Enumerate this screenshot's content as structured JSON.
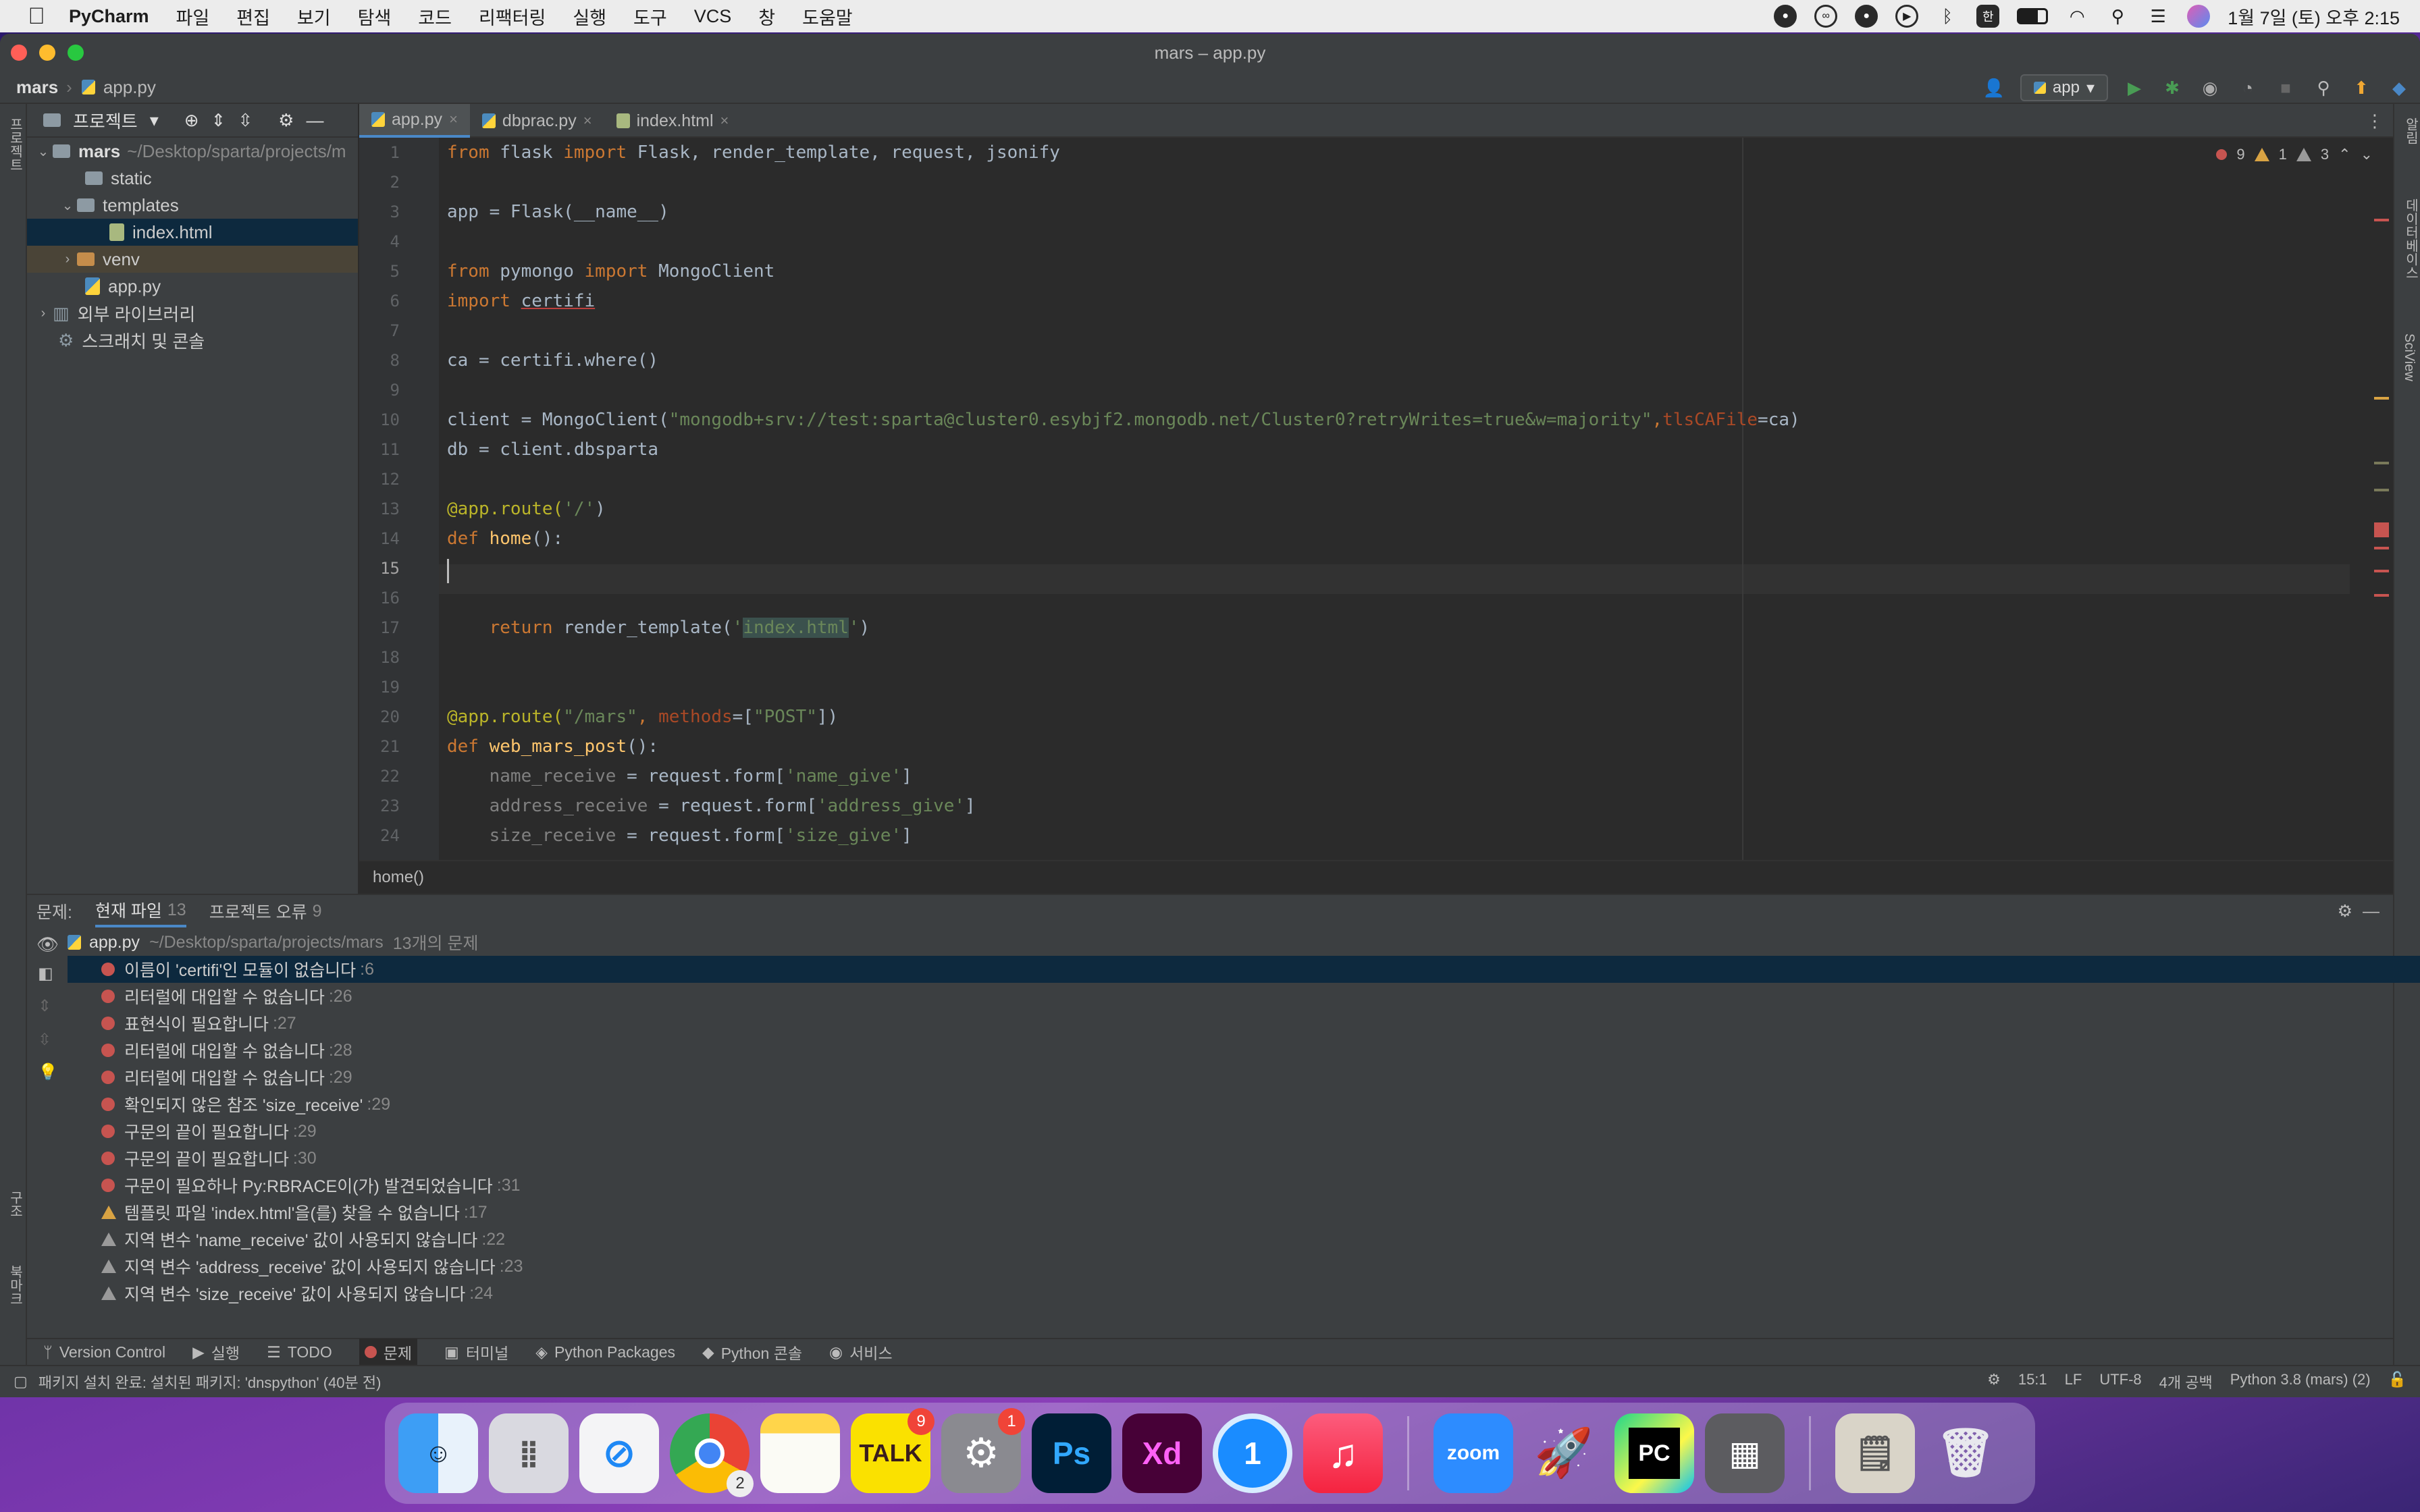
{
  "menubar": {
    "app": "PyCharm",
    "items": [
      "파일",
      "편집",
      "보기",
      "탐색",
      "코드",
      "리팩터링",
      "실행",
      "도구",
      "VCS",
      "창",
      "도움말"
    ],
    "clock": "1월 7일 (토) 오후 2:15",
    "ime": "한"
  },
  "window": {
    "title": "mars – app.py",
    "breadcrumb_project": "mars",
    "breadcrumb_file": "app.py",
    "run_config": "app"
  },
  "project_panel": {
    "title": "프로젝트",
    "root_name": "mars",
    "root_path": "~/Desktop/sparta/projects/m",
    "items": {
      "static": "static",
      "templates": "templates",
      "index": "index.html",
      "venv": "venv",
      "app": "app.py",
      "ext_libs": "외부 라이브러리",
      "scratches": "스크래치 및 콘솔"
    }
  },
  "tabs": [
    "app.py",
    "dbprac.py",
    "index.html"
  ],
  "inspections": {
    "errors": "9",
    "warnings": "1",
    "weak_warnings": "3"
  },
  "editor": {
    "current_line": "15",
    "breadcrumb": "home()",
    "lines": [
      {
        "n": "1"
      },
      {
        "n": "2"
      },
      {
        "n": "3"
      },
      {
        "n": "4"
      },
      {
        "n": "5"
      },
      {
        "n": "6"
      },
      {
        "n": "7"
      },
      {
        "n": "8"
      },
      {
        "n": "9"
      },
      {
        "n": "10"
      },
      {
        "n": "11"
      },
      {
        "n": "12"
      },
      {
        "n": "13"
      },
      {
        "n": "14"
      },
      {
        "n": "15"
      },
      {
        "n": "16"
      },
      {
        "n": "17"
      },
      {
        "n": "18"
      },
      {
        "n": "19"
      },
      {
        "n": "20"
      },
      {
        "n": "21"
      },
      {
        "n": "22"
      },
      {
        "n": "23"
      },
      {
        "n": "24"
      }
    ],
    "code": {
      "l1_from": "from",
      "l1_mod": " flask ",
      "l1_import": "import",
      "l1_rest": " Flask, render_template, request, jsonify",
      "l3": "app = Flask(__name__)",
      "l5_from": "from",
      "l5_mod": " pymongo ",
      "l5_import": "import",
      "l5_rest": " MongoClient",
      "l6_import": "import",
      "l6_mod": "certifi",
      "l8": "ca = certifi.where()",
      "l10_a": "client = MongoClient(",
      "l10_str": "\"mongodb+srv://test:sparta@cluster0.esybjf2.mongodb.net/Cluster0?retryWrites=true&w=majority\"",
      "l10_comma": ",",
      "l10_param": "tlsCAFile",
      "l10_end": "=ca)",
      "l11": "db = client.dbsparta",
      "l13_dec": "@app.route(",
      "l13_str": "'/'",
      "l13_end": ")",
      "l14_def": "def",
      "l14_fn": " home",
      "l14_end": "():",
      "l17_ret": "return",
      "l17_call": " render_template(",
      "l17_q1": "'",
      "l17_str": "index.html",
      "l17_q2": "'",
      "l17_end": ")",
      "l20_dec": "@app.route(",
      "l20_str": "\"/mars\"",
      "l20_comma": ", ",
      "l20_param": "methods",
      "l20_eq": "=[",
      "l20_post": "\"POST\"",
      "l20_end": "])",
      "l21_def": "def",
      "l21_fn": " web_mars_post",
      "l21_end": "():",
      "l22_var": "name_receive",
      "l22_mid": " = request.form[",
      "l22_str": "'name_give'",
      "l22_end": "]",
      "l23_var": "address_receive",
      "l23_mid": " = request.form[",
      "l23_str": "'address_give'",
      "l23_end": "]",
      "l24_var": "size_receive",
      "l24_mid": " = request.form[",
      "l24_str": "'size_give'",
      "l24_end": "]"
    }
  },
  "problems": {
    "label": "문제:",
    "tab_current": "현재 파일",
    "tab_current_count": "13",
    "tab_project": "프로젝트 오류",
    "tab_project_count": "9",
    "file": "app.py",
    "file_path": "~/Desktop/sparta/projects/mars",
    "file_count": "13개의 문제",
    "items": [
      {
        "text": "이름이 'certifi'인 모듈이 없습니다",
        "line": ":6"
      },
      {
        "text": "리터럴에 대입할 수 없습니다",
        "line": ":26"
      },
      {
        "text": "표현식이 필요합니다",
        "line": ":27"
      },
      {
        "text": "리터럴에 대입할 수 없습니다",
        "line": ":28"
      },
      {
        "text": "리터럴에 대입할 수 없습니다",
        "line": ":29"
      },
      {
        "text": "확인되지 않은 참조 'size_receive'",
        "line": ":29"
      },
      {
        "text": "구문의 끝이 필요합니다",
        "line": ":29"
      },
      {
        "text": "구문의 끝이 필요합니다",
        "line": ":30"
      },
      {
        "text": "구문이 필요하나 Py:RBRACE이(가) 발견되었습니다",
        "line": ":31"
      },
      {
        "text": "템플릿 파일 'index.html'을(를) 찾을 수 없습니다",
        "line": ":17"
      },
      {
        "text": "지역 변수 'name_receive' 값이 사용되지 않습니다",
        "line": ":22"
      },
      {
        "text": "지역 변수 'address_receive' 값이 사용되지 않습니다",
        "line": ":23"
      },
      {
        "text": "지역 변수 'size_receive' 값이 사용되지 않습니다",
        "line": ":24"
      }
    ]
  },
  "bottom_tools": [
    "Version Control",
    "실행",
    "TODO",
    "문제",
    "터미널",
    "Python Packages",
    "Python 콘솔",
    "서비스"
  ],
  "status": {
    "message": "패키지 설치 완료: 설치된 패키지: 'dnspython' (40분 전)",
    "position": "15:1",
    "line_sep": "LF",
    "encoding": "UTF-8",
    "indent": "4개 공백",
    "interpreter": "Python 3.8 (mars) (2)"
  },
  "side_labels": {
    "left_top": "프로젝트",
    "left_mid": "구조",
    "left_bottom": "북마크",
    "right_top": "알림",
    "right_db": "데이터베이스",
    "right_sci": "SciView"
  },
  "dock": {
    "apps": [
      "finder",
      "launchpad",
      "safari",
      "chrome",
      "notes",
      "kakaotalk",
      "system-preferences",
      "photoshop",
      "xd",
      "1password",
      "music",
      "zoom",
      "rocket",
      "pycharm",
      "calculator",
      "preview",
      "trash"
    ],
    "badges": {
      "chrome": "2",
      "kakaotalk": "9",
      "system-preferences": "1"
    },
    "labels": {
      "talk": "TALK",
      "ps": "Ps",
      "xd": "Xd",
      "one": "1",
      "zoom": "zoom",
      "pc": "PC"
    }
  }
}
